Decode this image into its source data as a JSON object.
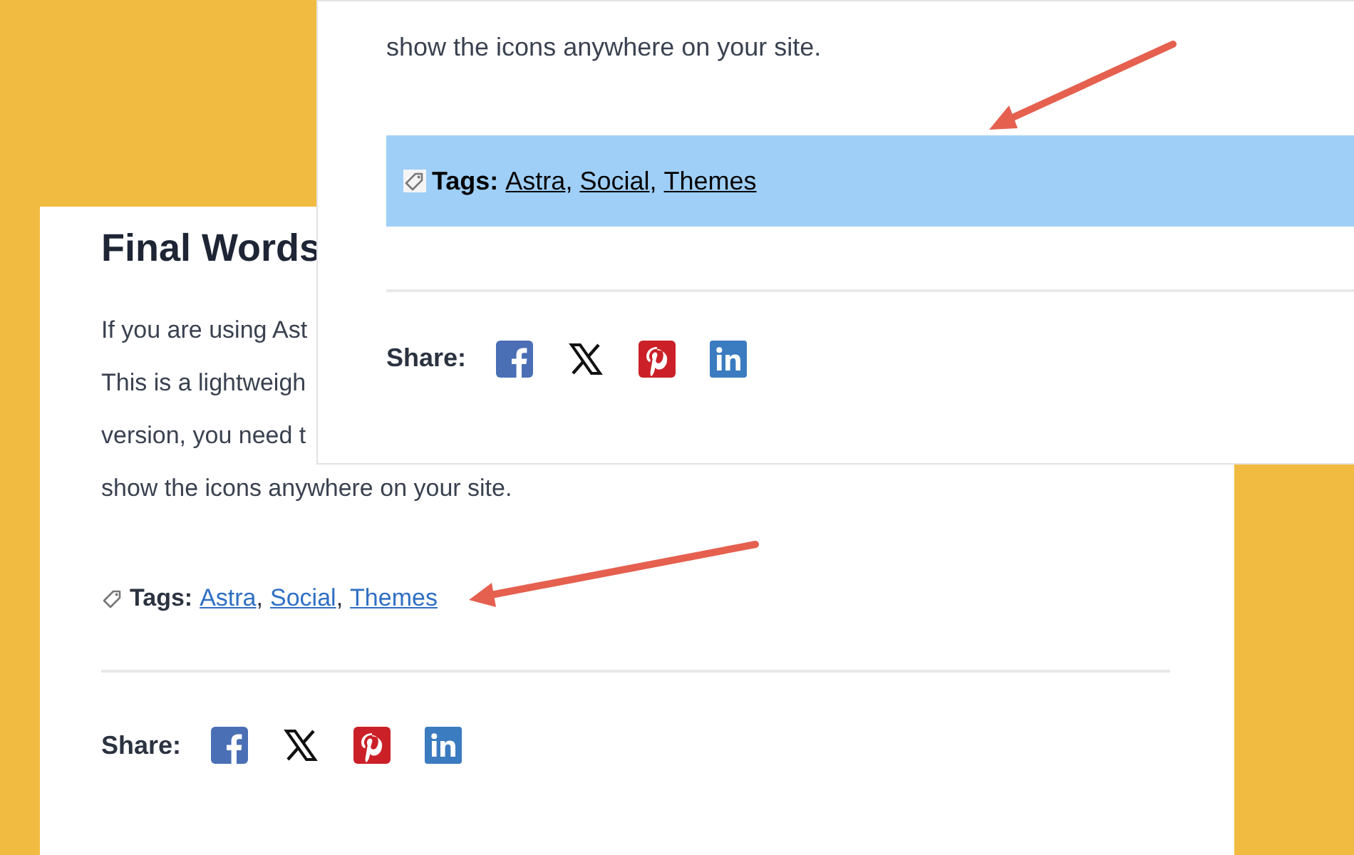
{
  "back_card": {
    "heading": "Final Words",
    "lines": [
      "If you are using Ast",
      "This is a lightweigh",
      "version, you need t",
      "show the icons anywhere on your site."
    ],
    "tags": {
      "label": "Tags:",
      "items": [
        "Astra",
        "Social",
        "Themes"
      ],
      "separator": ",",
      "highlighted": false
    },
    "share": {
      "label": "Share:",
      "networks": [
        {
          "kind": "facebook"
        },
        {
          "kind": "x"
        },
        {
          "kind": "pinterest"
        },
        {
          "kind": "linkedin"
        }
      ]
    }
  },
  "front_card": {
    "line": "show the icons anywhere on your site.",
    "tags": {
      "label": "Tags:",
      "items": [
        "Astra",
        "Social",
        "Themes"
      ],
      "separator": ",",
      "highlighted": true
    },
    "share": {
      "label": "Share:",
      "networks": [
        {
          "kind": "facebook"
        },
        {
          "kind": "x"
        },
        {
          "kind": "pinterest"
        },
        {
          "kind": "linkedin"
        }
      ]
    }
  }
}
